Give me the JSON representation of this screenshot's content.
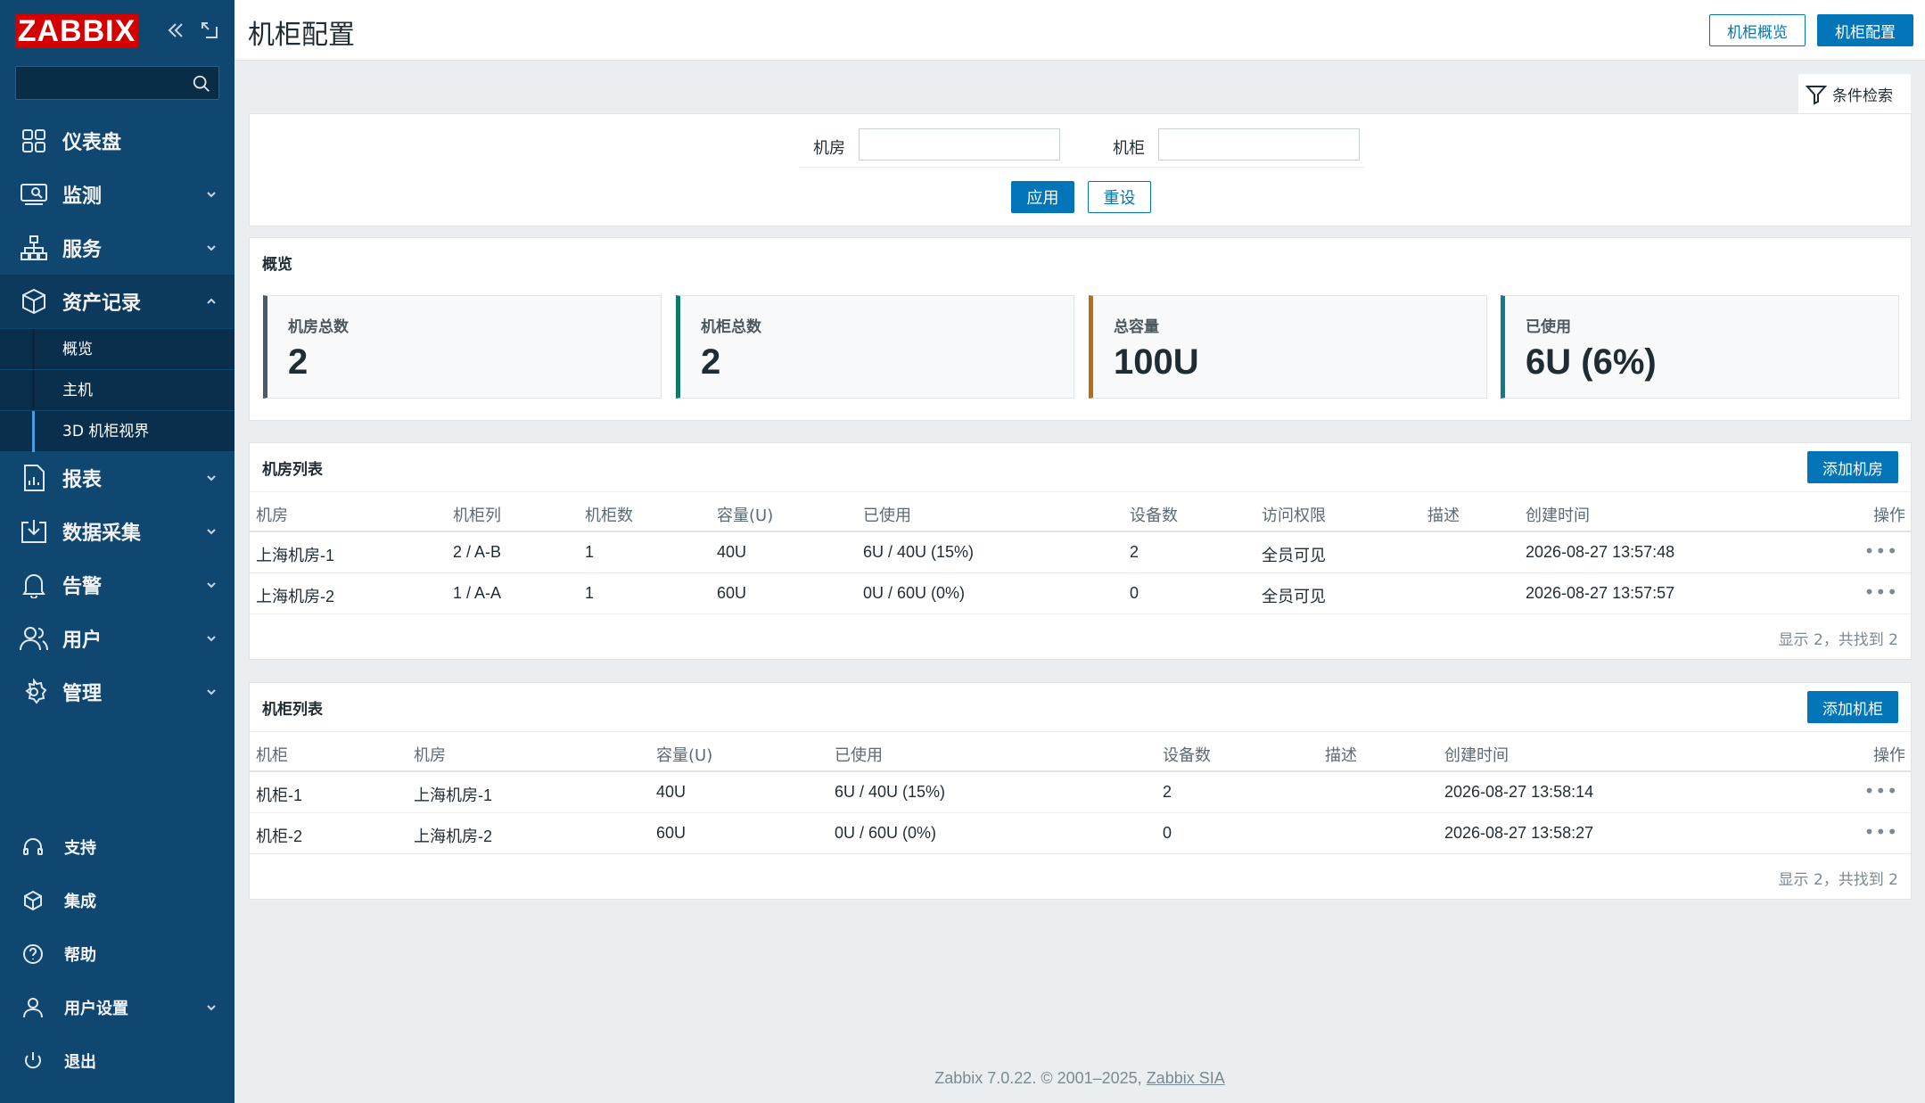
{
  "sidebar": {
    "logo": "ZABBIX",
    "search_placeholder": "",
    "menu": [
      {
        "label": "仪表盘",
        "icon": "dashboard-icon"
      },
      {
        "label": "监测",
        "icon": "monitoring-icon"
      },
      {
        "label": "服务",
        "icon": "services-icon"
      },
      {
        "label": "资产记录",
        "icon": "inventory-icon"
      },
      {
        "label": "报表",
        "icon": "reports-icon"
      },
      {
        "label": "数据采集",
        "icon": "data-collection-icon"
      },
      {
        "label": "告警",
        "icon": "alerts-icon"
      },
      {
        "label": "用户",
        "icon": "users-icon"
      },
      {
        "label": "管理",
        "icon": "administration-icon"
      }
    ],
    "submenu": [
      {
        "label": "概览"
      },
      {
        "label": "主机"
      },
      {
        "label": "3D 机柜视界"
      }
    ],
    "bottom": [
      {
        "label": "支持"
      },
      {
        "label": "集成"
      },
      {
        "label": "帮助"
      },
      {
        "label": "用户设置"
      },
      {
        "label": "退出"
      }
    ]
  },
  "header": {
    "title": "机柜配置",
    "btn_overview": "机柜概览",
    "btn_config": "机柜配置"
  },
  "filter": {
    "tab_label": "条件检索",
    "room_label": "机房",
    "room_value": "",
    "cabinet_label": "机柜",
    "cabinet_value": "",
    "apply": "应用",
    "reset": "重设"
  },
  "overview": {
    "title": "概览",
    "stats": [
      {
        "label": "机房总数",
        "value": "2",
        "color": "#4a5a66"
      },
      {
        "label": "机柜总数",
        "value": "2",
        "color": "#0e7a6a"
      },
      {
        "label": "总容量",
        "value": "100U",
        "color": "#b86e10"
      },
      {
        "label": "已使用",
        "value": "6U (6%)",
        "color": "#137a8c"
      }
    ]
  },
  "rooms": {
    "title": "机房列表",
    "add": "添加机房",
    "columns": [
      "机房",
      "机柜列",
      "机柜数",
      "容量(U)",
      "已使用",
      "设备数",
      "访问权限",
      "描述",
      "创建时间",
      "操作"
    ],
    "rows": [
      [
        "上海机房-1",
        "2 / A-B",
        "1",
        "40U",
        "6U / 40U (15%)",
        "2",
        "全员可见",
        "",
        "2026-08-27 13:57:48"
      ],
      [
        "上海机房-2",
        "1 / A-A",
        "1",
        "60U",
        "0U / 60U (0%)",
        "0",
        "全员可见",
        "",
        "2026-08-27 13:57:57"
      ]
    ],
    "footer": "显示 2，共找到 2"
  },
  "cabinets": {
    "title": "机柜列表",
    "add": "添加机柜",
    "columns": [
      "机柜",
      "机房",
      "容量(U)",
      "已使用",
      "设备数",
      "描述",
      "创建时间",
      "操作"
    ],
    "rows": [
      [
        "机柜-1",
        "上海机房-1",
        "40U",
        "6U / 40U (15%)",
        "2",
        "",
        "2026-08-27 13:58:14"
      ],
      [
        "机柜-2",
        "上海机房-2",
        "60U",
        "0U / 60U (0%)",
        "0",
        "",
        "2026-08-27 13:58:27"
      ]
    ],
    "footer": "显示 2，共找到 2"
  },
  "footer": {
    "text": "Zabbix 7.0.22. © 2001–2025, ",
    "link": "Zabbix SIA"
  }
}
